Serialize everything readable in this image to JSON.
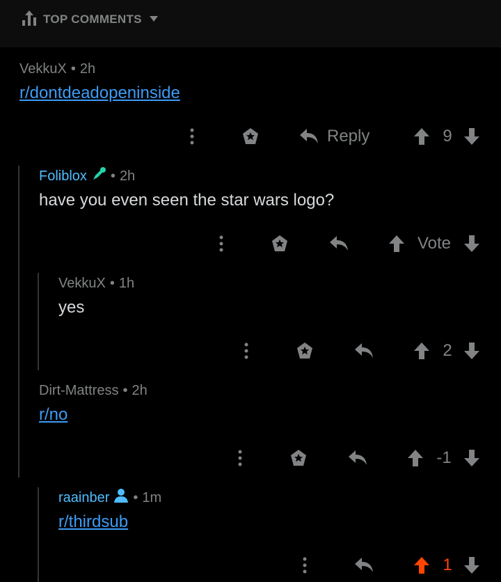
{
  "sort": {
    "label": "TOP COMMENTS"
  },
  "comments": [
    {
      "user": "VekkuX",
      "time": "2h",
      "body": "r/dontdeadopeninside",
      "reply_label": "Reply",
      "score": "9"
    },
    {
      "user": "Foliblox",
      "time": "2h",
      "body": "have you even seen the star wars logo?",
      "score": "Vote"
    },
    {
      "user": "VekkuX",
      "time": "1h",
      "body": "yes",
      "score": "2"
    },
    {
      "user": "Dirt-Mattress",
      "time": "2h",
      "body": "r/no",
      "score": "-1"
    },
    {
      "user": "raainber",
      "time": "1m",
      "body": "r/thirdsub",
      "score": "1"
    }
  ],
  "colors": {
    "upvoted": "#ff4500",
    "link": "#3d9bf5",
    "flair_user": "#4fbcff",
    "muted": "#818384"
  },
  "icons": [
    "sort-icon",
    "caret-down-icon",
    "more-icon",
    "award-icon",
    "reply-icon",
    "upvote-icon",
    "downvote-icon",
    "flair-pen-icon",
    "profile-icon"
  ]
}
